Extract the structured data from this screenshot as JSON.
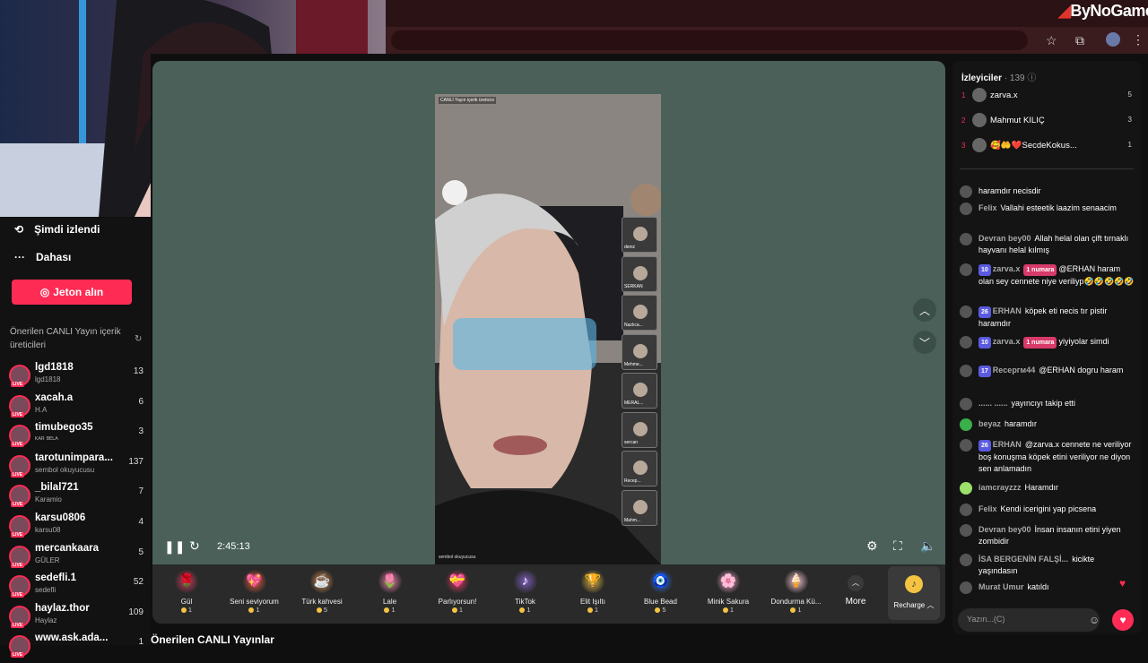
{
  "watermark": "ByNoGame",
  "sidebar": {
    "watched_label": "Şimdi izlendi",
    "more_label": "Dahası",
    "jeton_label": "Jeton alın",
    "recommended_heading": "Önerilen CANLI Yayın içerik üreticileri",
    "creators": [
      {
        "name": "lgd1818",
        "sub": "lgd1818",
        "count": "13"
      },
      {
        "name": "xacah.a",
        "sub": "H.A",
        "count": "6"
      },
      {
        "name": "timubego35",
        "sub": "ᴷᴬᴿ ᴮᴱᴸᴬ",
        "count": "3"
      },
      {
        "name": "tarotunimpara...",
        "sub": "sembol okuyucusu",
        "count": "137"
      },
      {
        "name": "_bilal721",
        "sub": "Karamio",
        "count": "7"
      },
      {
        "name": "karsu0806",
        "sub": "karsu08",
        "count": "4"
      },
      {
        "name": "mercankaara",
        "sub": "GÜLER",
        "count": "5"
      },
      {
        "name": "sedefli.1",
        "sub": "sedefli",
        "count": "52"
      },
      {
        "name": "haylaz.thor",
        "sub": "Haylaz",
        "count": "109"
      },
      {
        "name": "www.ask.ada...",
        "sub": "",
        "count": "1"
      }
    ],
    "live_badge": "LIVE"
  },
  "main": {
    "bottom_title": "Önerilen CANLI Yayınlar",
    "video_overlay": "CANLI Yayın içerik üreticisi",
    "guests": [
      "deniz",
      "SERKAN",
      "Nazlıca...",
      "Mehme...",
      "MERAL...",
      "sercan",
      "Recep...",
      "Mahm..."
    ],
    "video_caption": "sembol okuyucusu",
    "timecode": "2:45:13",
    "gifts": [
      {
        "name": "Gül",
        "price": "1",
        "icon": "🌹",
        "color": "#c93a5a"
      },
      {
        "name": "Seni seviyorum",
        "price": "1",
        "icon": "💖",
        "color": "#e55a3a"
      },
      {
        "name": "Türk kahvesi",
        "price": "5",
        "icon": "☕",
        "color": "#d98c4a"
      },
      {
        "name": "Lale",
        "price": "1",
        "icon": "🌷",
        "color": "#e87ca8"
      },
      {
        "name": "Parlıyorsun!",
        "price": "1",
        "icon": "💝",
        "color": "#d73a5a"
      },
      {
        "name": "TikTok",
        "price": "1",
        "icon": "♪",
        "color": "#7a5ab8"
      },
      {
        "name": "Elit Işıltı",
        "price": "1",
        "icon": "🏆",
        "color": "#d8b23a"
      },
      {
        "name": "Blue Bead",
        "price": "5",
        "icon": "🧿",
        "color": "#2a6ad8"
      },
      {
        "name": "Minik Sakura",
        "price": "1",
        "icon": "🌸",
        "color": "#e8a0c0"
      },
      {
        "name": "Dondurma Kü...",
        "price": "1",
        "icon": "🍦",
        "color": "#f2c0d0"
      }
    ],
    "more_label": "More",
    "recharge_label": "Recharge"
  },
  "viewers": {
    "title": "İzleyiciler",
    "count": "· 139",
    "list": [
      {
        "rank": "1",
        "name": "zarva.x",
        "count": "5"
      },
      {
        "rank": "2",
        "name": "Mahmut KILIÇ",
        "count": "3"
      },
      {
        "rank": "3",
        "name": "🥰🤲❤️SecdeKokus...",
        "count": "1"
      }
    ]
  },
  "chat": {
    "messages": [
      {
        "user": "",
        "text": "haramdır necisdir"
      },
      {
        "user": "Felix",
        "text": "Vallahi esteetik laazim senaacim"
      },
      {
        "user": "Devran bey00",
        "text": "Allah helal olan çift tırnaklı hayvanı helal kılmış"
      },
      {
        "user": "zarva.x",
        "level": "10",
        "badge": "1 numara",
        "text": "@ERHAN haram olan sey cennete niye veriliyp🤣🤣🤣🤣🤣"
      },
      {
        "user": "ERHAN",
        "level": "26",
        "text": "köpek eti necis tır pistir haramdır"
      },
      {
        "user": "zarva.x",
        "level": "10",
        "badge": "1 numara",
        "text": "yiyiyolar simdi"
      },
      {
        "user": "Recepгм44",
        "level": "17",
        "text": "@ERHAN dogru haram"
      },
      {
        "user": "...... ......",
        "text": "yayıncıyı takip etti"
      },
      {
        "user": "beyaz",
        "text": "haramdır"
      },
      {
        "user": "ERHAN",
        "level": "26",
        "text": "@zarva.x cennete ne veriliyor boş konuşma köpek etini veriliyor ne diyon sen anlamadın"
      },
      {
        "user": "iamcrayzzz",
        "text": "Haramdır"
      },
      {
        "user": "Felix",
        "text": "Kendi icerigini yap picsena"
      },
      {
        "user": "Devran bey00",
        "text": "İnsan insanın etini yiyen zombidir"
      },
      {
        "user": "İSA BERGENİN FALŞİ...",
        "text": "kicikte yaşındasın"
      },
      {
        "user": "Murat Umur",
        "text": "katıldı"
      }
    ],
    "input_placeholder": "Yazın...(C)"
  }
}
